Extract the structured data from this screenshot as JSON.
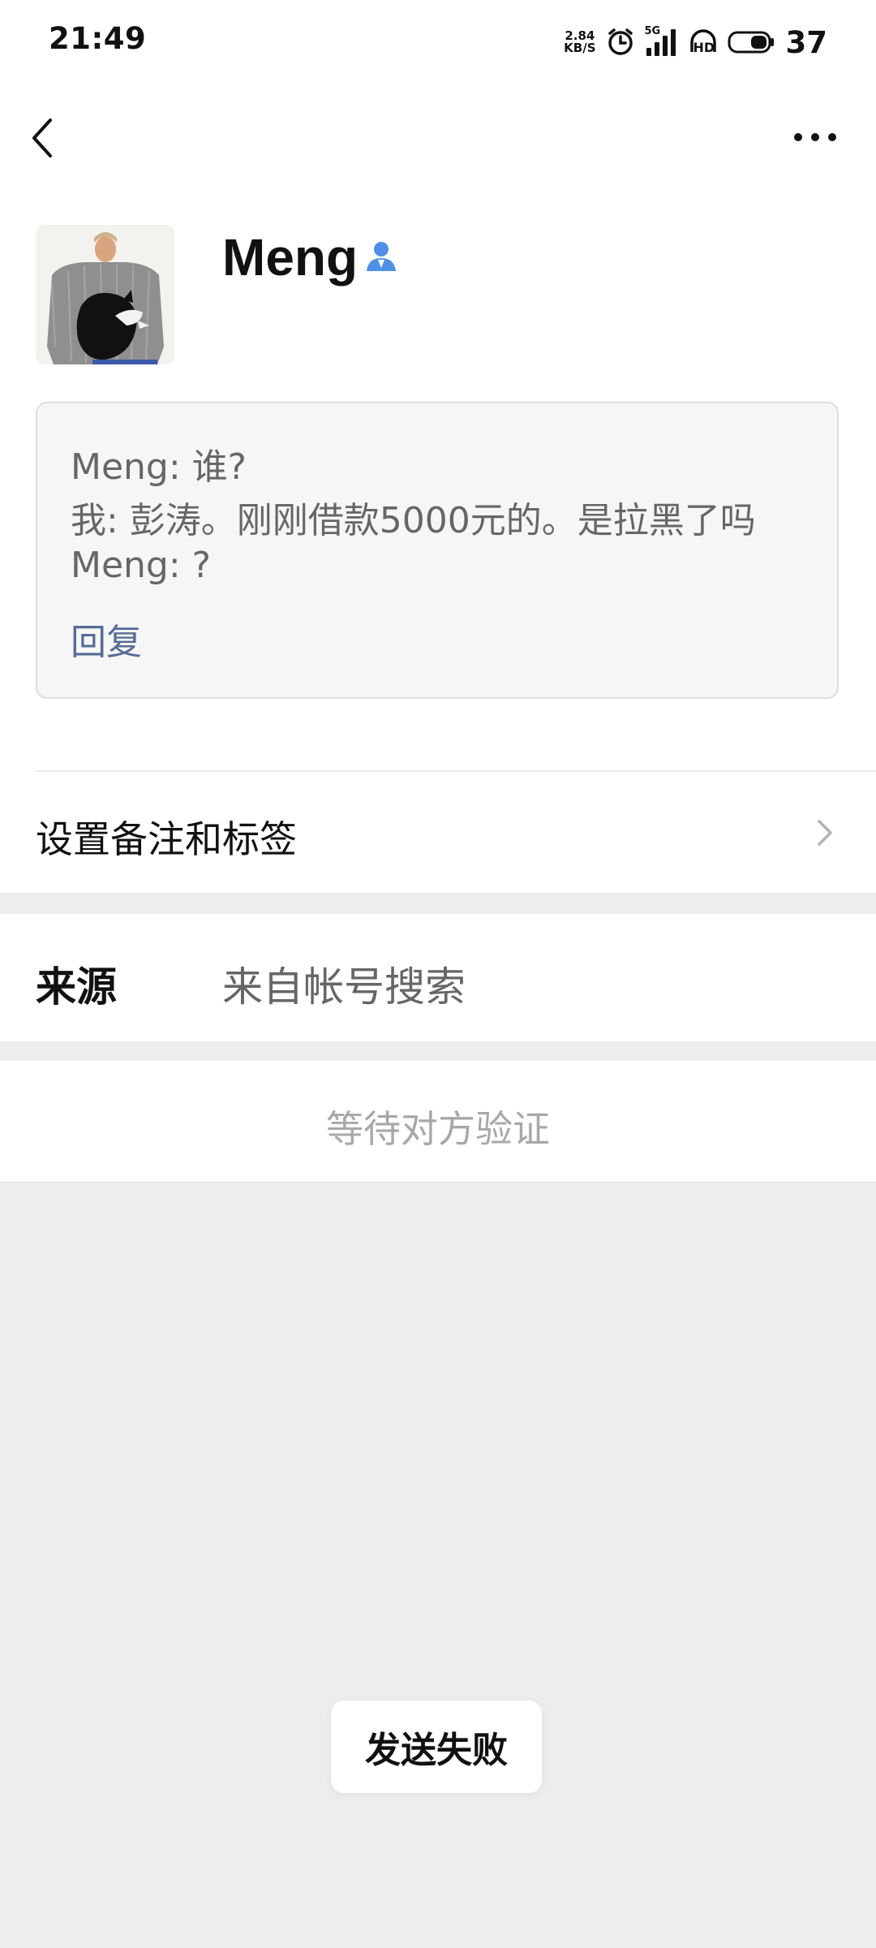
{
  "status_bar": {
    "time": "21:49",
    "net_speed_value": "2.84",
    "net_speed_unit": "KB/S",
    "signal_label": "5G",
    "hd_label": "HD",
    "battery_level": "37",
    "icons": [
      "alarm-icon",
      "signal-icon",
      "hd-icon",
      "battery-icon"
    ]
  },
  "nav": {
    "back_icon": "chevron-left-icon",
    "more_icon": "more-dots-icon"
  },
  "profile": {
    "name": "Meng",
    "badge_icon": "contact-person-icon",
    "badge_color": "#4f8fe6"
  },
  "message_box": {
    "lines": [
      "Meng: 谁?",
      "我: 彭涛。刚刚借款5000元的。是拉黑了吗",
      "Meng: ?"
    ],
    "reply_label": "回复",
    "reply_color": "#576b95"
  },
  "settings": {
    "remark_label": "设置备注和标签"
  },
  "source": {
    "key": "来源",
    "value": "来自帐号搜索"
  },
  "verification": {
    "status_label": "等待对方验证"
  },
  "toast": {
    "message": "发送失败"
  }
}
